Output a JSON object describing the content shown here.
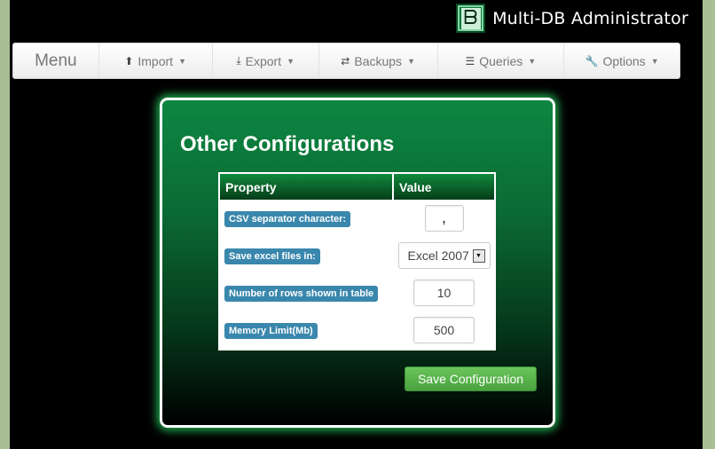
{
  "app": {
    "title": "Multi-DB Administrator",
    "logo_letter": "DB"
  },
  "nav": {
    "brand": "Menu",
    "items": [
      {
        "label": "Import",
        "icon": "upload-circle-icon"
      },
      {
        "label": "Export",
        "icon": "download-icon"
      },
      {
        "label": "Backups",
        "icon": "retweet-icon"
      },
      {
        "label": "Queries",
        "icon": "list-icon"
      },
      {
        "label": "Options",
        "icon": "wrench-icon"
      }
    ]
  },
  "config": {
    "title": "Other Configurations",
    "headers": {
      "property": "Property",
      "value": "Value"
    },
    "rows": [
      {
        "label": "CSV separator character:",
        "value": ","
      },
      {
        "label": "Save excel files in:",
        "value": "Excel 2007"
      },
      {
        "label": "Number of rows shown in table",
        "value": "10"
      },
      {
        "label": "Memory Limit(Mb)",
        "value": "500"
      }
    ],
    "save_label": "Save Configuration"
  },
  "colors": {
    "panel_green": "#0d8742",
    "badge_blue": "#3a87ad",
    "button_green": "#5cb85c"
  }
}
